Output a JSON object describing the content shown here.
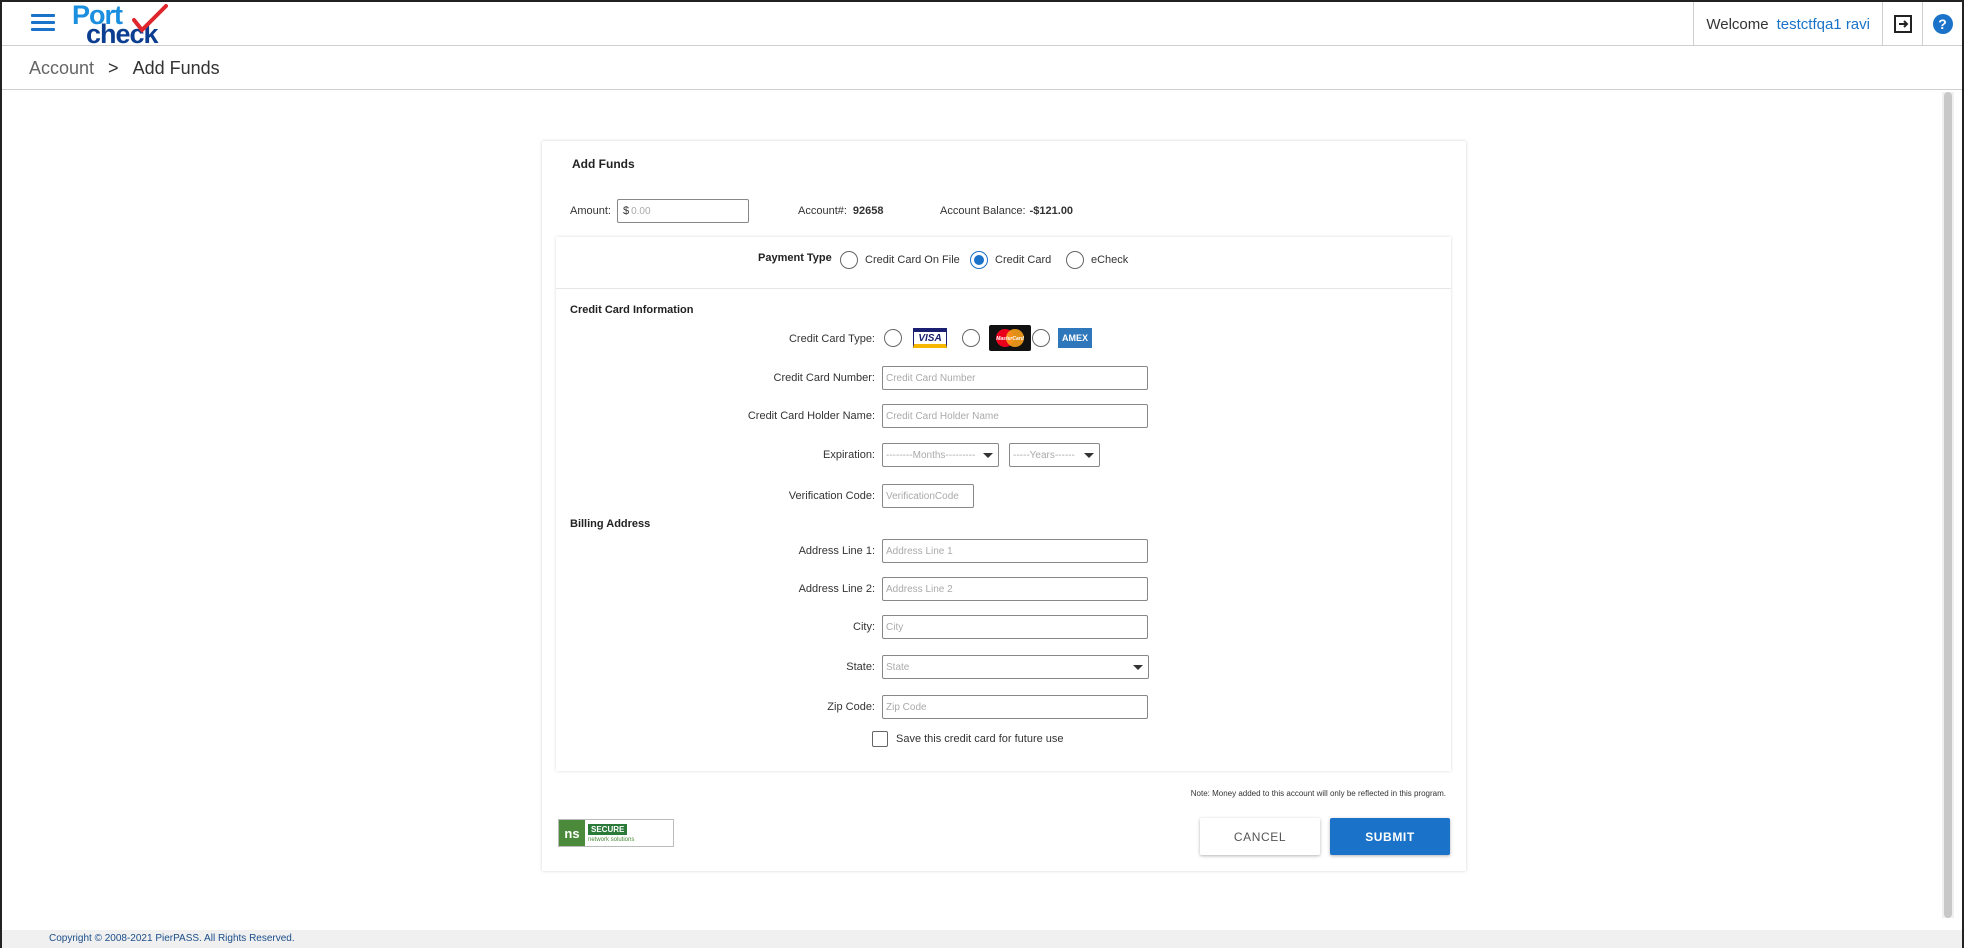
{
  "header": {
    "logo_top": "Port",
    "logo_bottom": "check",
    "welcome_label": "Welcome",
    "username": "testctfqa1 ravi",
    "icons": {
      "menu": "hamburger-icon",
      "logout": "logout-icon",
      "help": "help-icon"
    },
    "help_glyph": "?"
  },
  "breadcrumb": {
    "parent": "Account",
    "separator": ">",
    "current": "Add Funds"
  },
  "form": {
    "title": "Add Funds",
    "amount_label": "Amount:",
    "amount_prefix": "$",
    "amount_placeholder": "0.00",
    "account_label": "Account#:",
    "account_number": "92658",
    "balance_label": "Account Balance:",
    "balance_value": "-$121.00",
    "payment_type_label": "Payment Type",
    "payment_options": [
      {
        "label": "Credit Card On File",
        "selected": false
      },
      {
        "label": "Credit Card",
        "selected": true
      },
      {
        "label": "eCheck",
        "selected": false
      }
    ],
    "cc_section_label": "Credit Card Information",
    "cc_type_label": "Credit Card Type:",
    "card_brands": [
      "VISA",
      "MasterCard",
      "AMEX"
    ],
    "cc_number_label": "Credit Card Number:",
    "cc_number_placeholder": "Credit Card Number",
    "cc_holder_label": "Credit Card Holder Name:",
    "cc_holder_placeholder": "Credit Card Holder Name",
    "expiration_label": "Expiration:",
    "months_placeholder": "--------Months---------",
    "years_placeholder": "-----Years------",
    "cvv_label": "Verification Code:",
    "cvv_placeholder": "VerificationCode",
    "billing_section_label": "Billing Address",
    "addr1_label": "Address Line 1:",
    "addr1_placeholder": "Address Line 1",
    "addr2_label": "Address Line 2:",
    "addr2_placeholder": "Address Line 2",
    "city_label": "City:",
    "city_placeholder": "City",
    "state_label": "State:",
    "state_placeholder": "State",
    "zip_label": "Zip Code:",
    "zip_placeholder": "Zip Code",
    "save_card_label": "Save this credit card for future use",
    "note": "Note: Money added to this account will only be reflected in this program.",
    "secure_badge": {
      "logo": "ns",
      "text": "SECURE",
      "sub": "network solutions"
    },
    "cancel_label": "CANCEL",
    "submit_label": "SUBMIT"
  },
  "footer": {
    "copyright": "Copyright © 2008-2021 PierPASS. All Rights Reserved."
  },
  "colors": {
    "accent": "#1a73c8",
    "logo_check": "#e0262c",
    "logo_dark": "#0b3d91"
  }
}
